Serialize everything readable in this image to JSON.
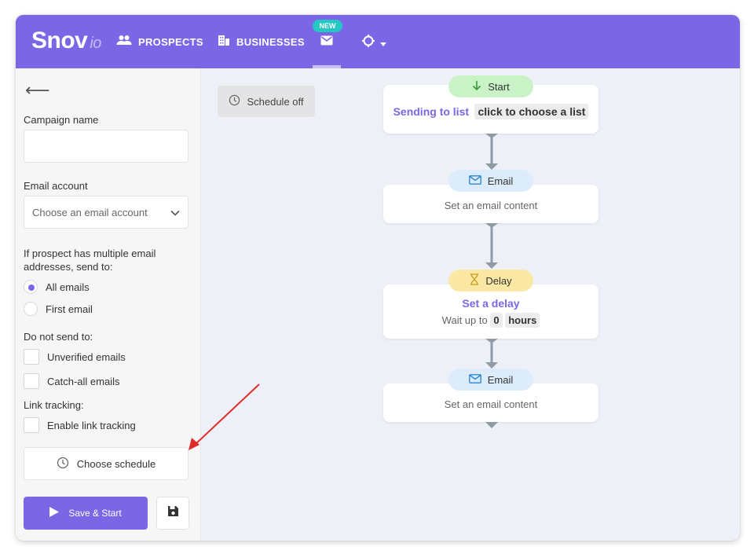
{
  "header": {
    "logo_main": "Snov",
    "logo_suffix": "io",
    "nav_prospects": "PROSPECTS",
    "nav_businesses": "BUSINESSES",
    "new_badge": "NEW"
  },
  "colors": {
    "brand": "#7b67e6",
    "start_pill": "#c9f2c7",
    "email_pill": "#dcecfb",
    "delay_pill": "#fbe8a4",
    "connector": "#8e9aa4"
  },
  "sidebar": {
    "campaign_name_label": "Campaign name",
    "campaign_name_value": "",
    "email_account_label": "Email account",
    "email_account_placeholder": "Choose an email account",
    "multiple_label": "If prospect has multiple email addresses, send to:",
    "radio_all": "All emails",
    "radio_first": "First email",
    "do_not_send_label": "Do not send to:",
    "unverified": "Unverified emails",
    "catch_all": "Catch-all emails",
    "link_tracking_label": "Link tracking:",
    "enable_link_tracking": "Enable link tracking",
    "choose_schedule": "Choose schedule",
    "save_start": "Save & Start"
  },
  "canvas": {
    "schedule_off": "Schedule off",
    "start": {
      "pill": "Start",
      "sending_to": "Sending to list",
      "choose_list": "click to choose a list"
    },
    "email1": {
      "pill": "Email",
      "text": "Set an email content"
    },
    "delay": {
      "pill": "Delay",
      "title": "Set a delay",
      "wait_prefix": "Wait up to",
      "value": "0",
      "unit": "hours"
    },
    "email2": {
      "pill": "Email",
      "text": "Set an email content"
    }
  }
}
